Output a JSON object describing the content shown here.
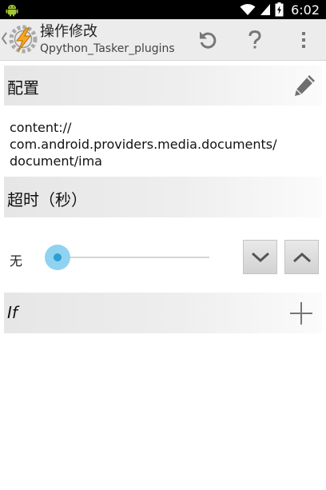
{
  "status_bar": {
    "time": "6:02",
    "icons": [
      "android-icon",
      "wifi-icon",
      "signal-icon",
      "battery-icon"
    ]
  },
  "action_bar": {
    "title": "操作修改",
    "subtitle": "Qpython_Tasker_plugins",
    "icons": [
      "back-arrow-icon",
      "tasker-logo-icon",
      "undo-icon",
      "help-icon",
      "overflow-menu-icon"
    ]
  },
  "sections": {
    "config": {
      "title": "配置",
      "value": "content://\ncom.android.providers.media.documents/\ndocument/ima",
      "icon": "pencil-icon"
    },
    "timeout": {
      "title": "超时（秒）",
      "slider_value_label": "无",
      "slider_level": 0,
      "stepper_icons": [
        "chevron-down-icon",
        "chevron-up-icon"
      ]
    },
    "if": {
      "title": "If",
      "icon": "plus-icon"
    }
  },
  "colors": {
    "status_bar_bg": "#000000",
    "action_bar_bg": "#ececec",
    "slider_thumb": "#8fd3f0",
    "slider_thumb_center": "#2c9fd6",
    "section_header_bg": "#e8e8e8"
  }
}
